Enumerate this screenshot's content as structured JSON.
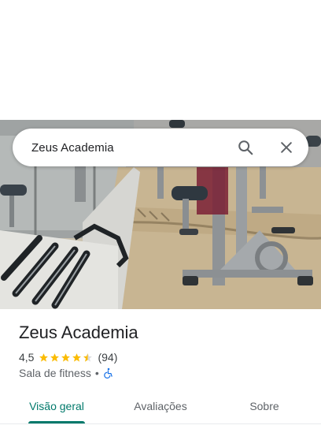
{
  "search": {
    "query": "Zeus Academia"
  },
  "place": {
    "name": "Zeus Academia",
    "rating": "4,5",
    "rating_stars": 4.5,
    "review_count": "(94)",
    "category": "Sala de fitness",
    "separator": "•",
    "accessibility_icon": "wheelchair-icon"
  },
  "tabs": [
    {
      "label": "Visão geral",
      "active": true
    },
    {
      "label": "Avaliações",
      "active": false
    },
    {
      "label": "Sobre",
      "active": false
    }
  ],
  "colors": {
    "accent": "#00796b",
    "star": "#fbbc04",
    "accessibility": "#1a73e8"
  }
}
